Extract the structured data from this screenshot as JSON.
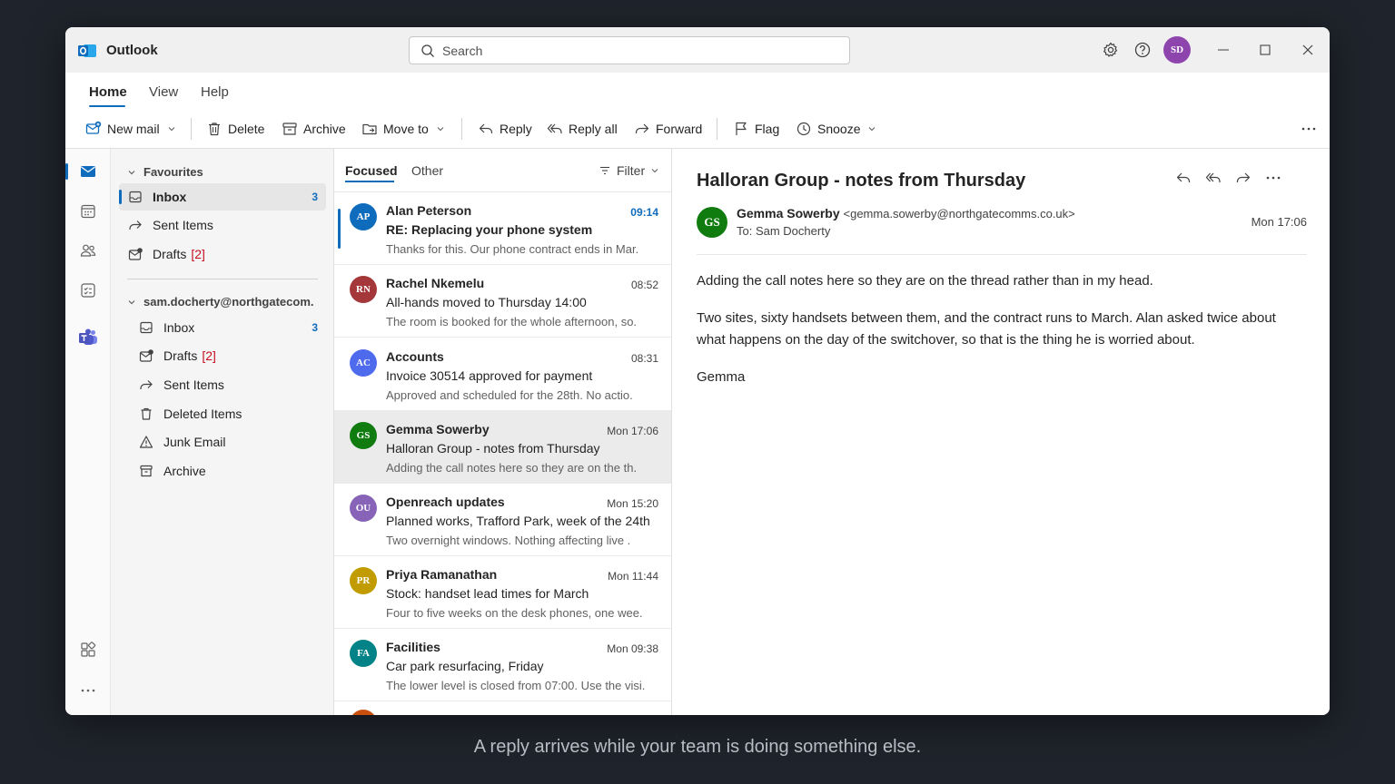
{
  "app": {
    "name": "Outlook",
    "user_initials": "SD"
  },
  "search": {
    "placeholder": "Search"
  },
  "menu": {
    "tabs": [
      "Home",
      "View",
      "Help"
    ]
  },
  "ribbon": {
    "new_mail": "New mail",
    "delete": "Delete",
    "archive": "Archive",
    "move_to": "Move to",
    "reply": "Reply",
    "reply_all": "Reply all",
    "forward": "Forward",
    "flag": "Flag",
    "snooze": "Snooze"
  },
  "folders": {
    "favourites_label": "Favourites",
    "favourites": [
      {
        "label": "Inbox",
        "count": "3"
      },
      {
        "label": "Sent Items"
      },
      {
        "label": "Drafts",
        "count": "[2]"
      }
    ],
    "account_label": "sam.docherty@northgatecom.",
    "account_items": [
      {
        "label": "Inbox",
        "count": "3"
      },
      {
        "label": "Drafts",
        "count": "[2]"
      },
      {
        "label": "Sent Items"
      },
      {
        "label": "Deleted Items"
      },
      {
        "label": "Junk Email"
      },
      {
        "label": "Archive"
      }
    ]
  },
  "list": {
    "tab_focused": "Focused",
    "tab_other": "Other",
    "filter": "Filter",
    "messages": [
      {
        "initials": "AP",
        "color": "#0f6cbd",
        "sender": "Alan Peterson",
        "time": "09:14",
        "subject": "RE: Replacing your phone system",
        "preview": "Thanks for this. Our phone contract ends in Mar."
      },
      {
        "initials": "RN",
        "color": "#a4373a",
        "sender": "Rachel Nkemelu",
        "time": "08:52",
        "subject": "All-hands moved to Thursday 14:00",
        "preview": "The room is booked for the whole afternoon, so."
      },
      {
        "initials": "AC",
        "color": "#4f6bed",
        "sender": "Accounts",
        "time": "08:31",
        "subject": "Invoice 30514 approved for payment",
        "preview": "Approved and scheduled for the 28th. No actio."
      },
      {
        "initials": "GS",
        "color": "#107c10",
        "sender": "Gemma Sowerby",
        "time": "Mon 17:06",
        "subject": "Halloran Group - notes from Thursday",
        "preview": "Adding the call notes here so they are on the th."
      },
      {
        "initials": "OU",
        "color": "#8764b8",
        "sender": "Openreach updates",
        "time": "Mon 15:20",
        "subject": "Planned works, Trafford Park, week of the 24th",
        "preview": "Two overnight windows. Nothing affecting live ."
      },
      {
        "initials": "PR",
        "color": "#c19c00",
        "sender": "Priya Ramanathan",
        "time": "Mon 11:44",
        "subject": "Stock: handset lead times for March",
        "preview": "Four to five weeks on the desk phones, one wee."
      },
      {
        "initials": "FA",
        "color": "#038387",
        "sender": "Facilities",
        "time": "Mon 09:38",
        "subject": "Car park resurfacing, Friday",
        "preview": "The lower level is closed from 07:00. Use the visi."
      }
    ]
  },
  "reading": {
    "subject": "Halloran Group - notes from Thursday",
    "sender_initials": "GS",
    "sender_name": "Gemma Sowerby",
    "sender_email": "<gemma.sowerby@northgatecomms.co.uk>",
    "to": "To: Sam Docherty",
    "date": "Mon 17:06",
    "body": [
      "Adding the call notes here so they are on the thread rather than in my head.",
      "Two sites, sixty handsets between them, and the contract runs to March. Alan asked twice about what happens on the day of the switchover, so that is the thing he is worried about.",
      "Gemma"
    ]
  },
  "caption": "A reply arrives while your team is doing something else."
}
